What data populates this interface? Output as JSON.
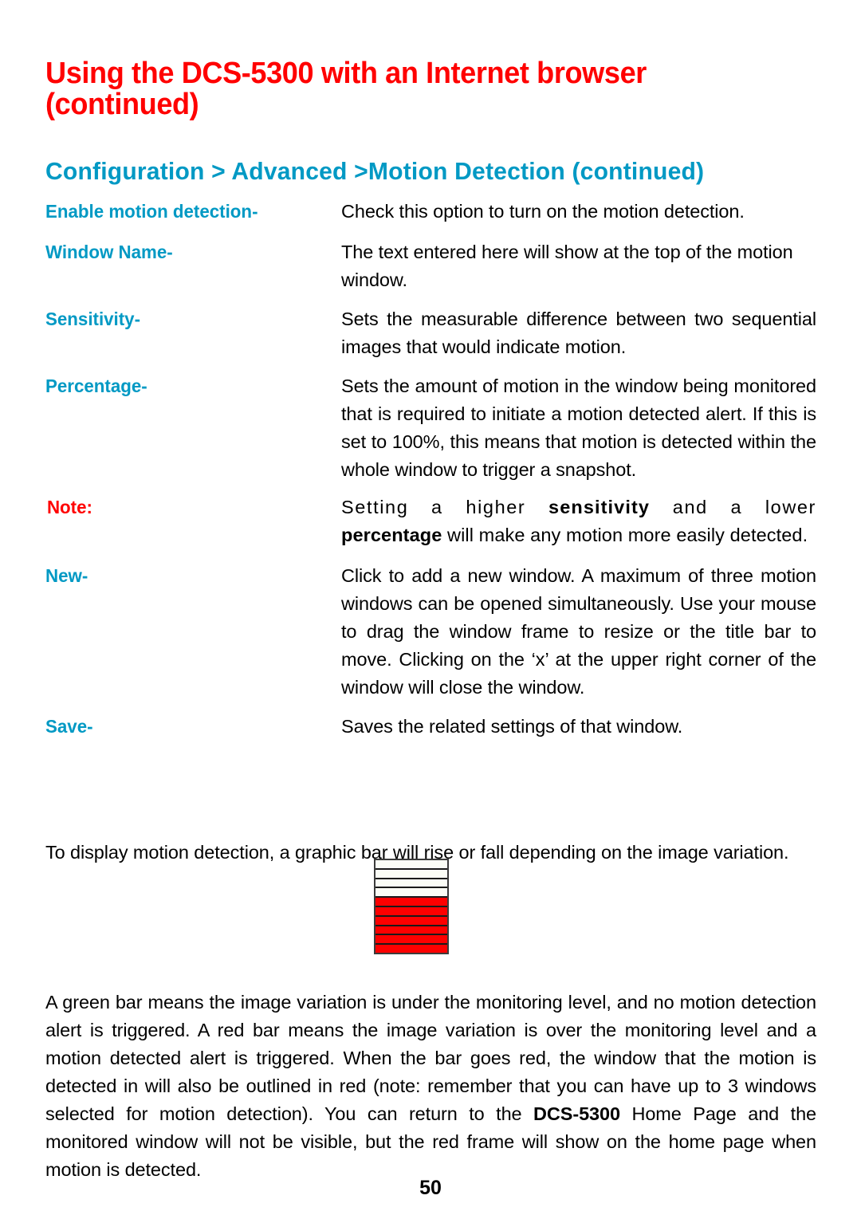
{
  "page": {
    "title": "Using the DCS-5300 with an Internet browser (continued)",
    "section_title": "Configuration > Advanced >Motion Detection (continued)",
    "page_number": "50",
    "title_color": "#ff0000",
    "accent_color": "#0099c4",
    "note_color": "#ff0000",
    "body_color": "#000000"
  },
  "definitions": [
    {
      "term": "Enable motion detection",
      "dash": "-",
      "description": "Check this option to turn on the motion detection."
    },
    {
      "term": "Window Name",
      "dash": "-",
      "description": "The text entered here will show at the top of the motion window."
    },
    {
      "term": "Sensitivity",
      "dash": "-",
      "description": "Sets the measurable difference between two sequential images that would indicate motion."
    },
    {
      "term": "Percentage",
      "dash": "-",
      "description": "Sets the amount of motion in the window being monitored that is required to initiate a motion detected alert. If this is set to 100%, this means that motion is detected within the whole window to trigger a snapshot."
    },
    {
      "term": "Note:",
      "dash": "",
      "description_parts": {
        "part1": "Setting a higher ",
        "bold1": "sensitivity",
        "part2": " and a lower ",
        "bold2": "percentage",
        "part3": " will make any motion more easily detected."
      }
    },
    {
      "term": "New",
      "dash": "-",
      "description": "Click to add a new window. A maximum of three motion windows can be opened simultaneously. Use your mouse to drag the window frame to resize or the title bar to move. Clicking on the ‘x’ at the upper right corner of the window will close the window."
    },
    {
      "term": "Save",
      "dash": "-",
      "description": "Saves the related settings of that window."
    }
  ],
  "paragraphs": {
    "graphic_intro": "To display motion detection, a graphic bar will rise or fall depending on the image variation.",
    "final_part1": "A green bar means the image variation is under the monitoring level, and no motion detection alert is triggered. A red bar means the image variation is over the monitoring level and a motion detected alert is triggered.  When the bar goes red, the window that the motion is detected in will also be outlined in red (note: remember that you can have up to 3 windows selected for motion detection). You can return to the ",
    "final_bold": "DCS-5300",
    "final_part2": " Home Page and the monitored window will not be visible, but the red frame will show on the home page when motion is detected."
  },
  "graphic_bar": {
    "total_segments": 10,
    "filled_segments": 6,
    "empty_segments": 4,
    "filled_color": "#fe0000",
    "empty_color": "#fbfdf6",
    "border_color": "#1a1a1a",
    "state": "red"
  }
}
